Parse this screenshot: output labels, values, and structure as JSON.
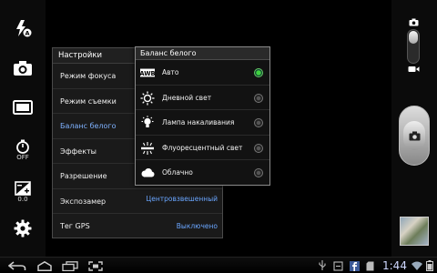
{
  "left_toolbar": {
    "timer_sub": "OFF",
    "exposure_sub": "0.0"
  },
  "settings": {
    "title": "Настройки",
    "rows": [
      {
        "label": "Режим фокуса",
        "value": ""
      },
      {
        "label": "Режим съемки",
        "value": ""
      },
      {
        "label": "Баланс белого",
        "value": ""
      },
      {
        "label": "Эффекты",
        "value": ""
      },
      {
        "label": "Разрешение",
        "value": ""
      },
      {
        "label": "Экспозамер",
        "value": "Центровзвешенный"
      },
      {
        "label": "Тег GPS",
        "value": "Выключено"
      }
    ]
  },
  "white_balance": {
    "title": "Баланс белого",
    "options": [
      {
        "label": "Авто",
        "icon": "awb-icon",
        "selected": true
      },
      {
        "label": "Дневной свет",
        "icon": "sun-icon",
        "selected": false
      },
      {
        "label": "Лампа накаливания",
        "icon": "bulb-icon",
        "selected": false
      },
      {
        "label": "Флуоресцентный свет",
        "icon": "fluorescent-icon",
        "selected": false
      },
      {
        "label": "Облачно",
        "icon": "cloud-icon",
        "selected": false
      }
    ]
  },
  "status_bar": {
    "time": "1:44"
  },
  "colors": {
    "accent_blue": "#6aa6ff",
    "selected_green": "#3fd23f"
  }
}
